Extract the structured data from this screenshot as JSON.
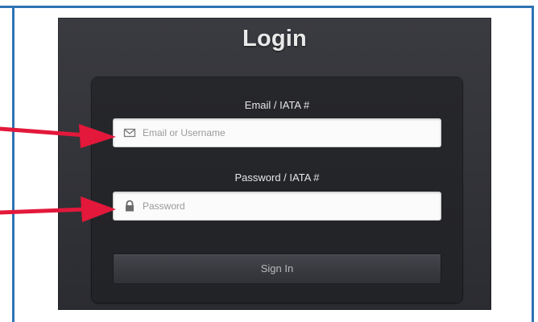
{
  "login": {
    "title": "Login",
    "email_label": "Email / IATA #",
    "email_placeholder": "Email or Username",
    "password_label": "Password / IATA #",
    "password_placeholder": "Password",
    "signin_label": "Sign In"
  },
  "icons": {
    "email": "envelope-icon",
    "password": "lock-icon",
    "annotation": "arrow-icon"
  },
  "colors": {
    "frame": "#2f73b4",
    "panel": "#323338",
    "form_box": "#232428",
    "arrow": "#e3183b"
  }
}
